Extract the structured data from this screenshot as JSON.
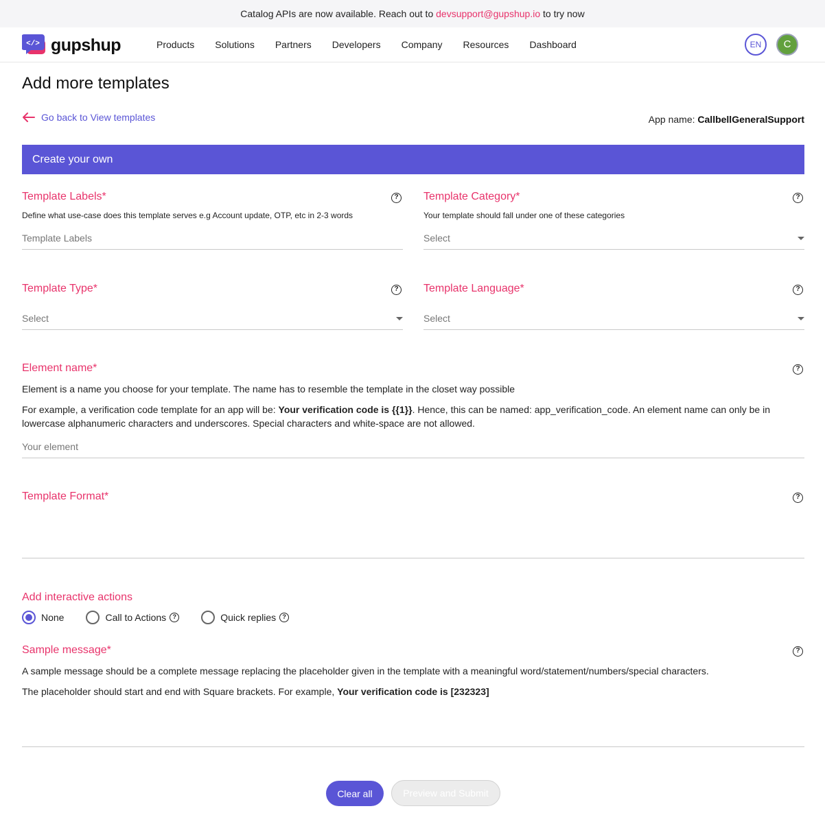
{
  "announcement": {
    "text_before": "Catalog APIs are now available. Reach out to ",
    "email": "devsupport@gupshup.io",
    "text_after": " to try now"
  },
  "nav": {
    "brand": "gupshup",
    "menu": [
      "Products",
      "Solutions",
      "Partners",
      "Developers",
      "Company",
      "Resources",
      "Dashboard"
    ],
    "language": "EN",
    "avatar_initial": "C"
  },
  "page": {
    "title": "Add more templates",
    "back_link": "Go back to View templates",
    "app_name_label": "App name:",
    "app_name_value": "CallbellGeneralSupport"
  },
  "banner": "Create your own",
  "form": {
    "template_labels": {
      "label": "Template Labels*",
      "description": "Define what use-case does this template serves e.g Account update, OTP, etc in 2-3 words",
      "placeholder": "Template Labels"
    },
    "template_category": {
      "label": "Template Category*",
      "description": "Your template should fall under one of these categories",
      "value": "Select"
    },
    "template_type": {
      "label": "Template Type*",
      "value": "Select"
    },
    "template_language": {
      "label": "Template Language*",
      "value": "Select"
    },
    "element_name": {
      "label": "Element name*",
      "description": "Element is a name you choose for your template. The name has to resemble the template in the closet way possible",
      "example_before": "For example, a verification code template for an app will be: ",
      "example_bold": "Your verification code is {{1}}",
      "example_after": ". Hence, this can be named: app_verification_code. An element name can only be in lowercase alphanumeric characters and underscores. Special characters and white-space are not allowed.",
      "placeholder": "Your element"
    },
    "template_format": {
      "label": "Template Format*"
    },
    "interactive_actions": {
      "label": "Add interactive actions",
      "options": [
        "None",
        "Call to Actions",
        "Quick replies"
      ],
      "selected": "None"
    },
    "sample_message": {
      "label": "Sample message*",
      "description": "A sample message should be a complete message replacing the placeholder given in the template with a meaningful word/statement/numbers/special characters.",
      "example_before": "The placeholder should start and end with Square brackets. For example, ",
      "example_bold": "Your verification code is [232323]"
    },
    "help_symbol": "?"
  },
  "buttons": {
    "clear": "Clear all",
    "preview": "Preview and Submit"
  },
  "colors": {
    "accent": "#5a55d6",
    "label_red": "#e8336b",
    "avatar_green": "#62a03d"
  }
}
